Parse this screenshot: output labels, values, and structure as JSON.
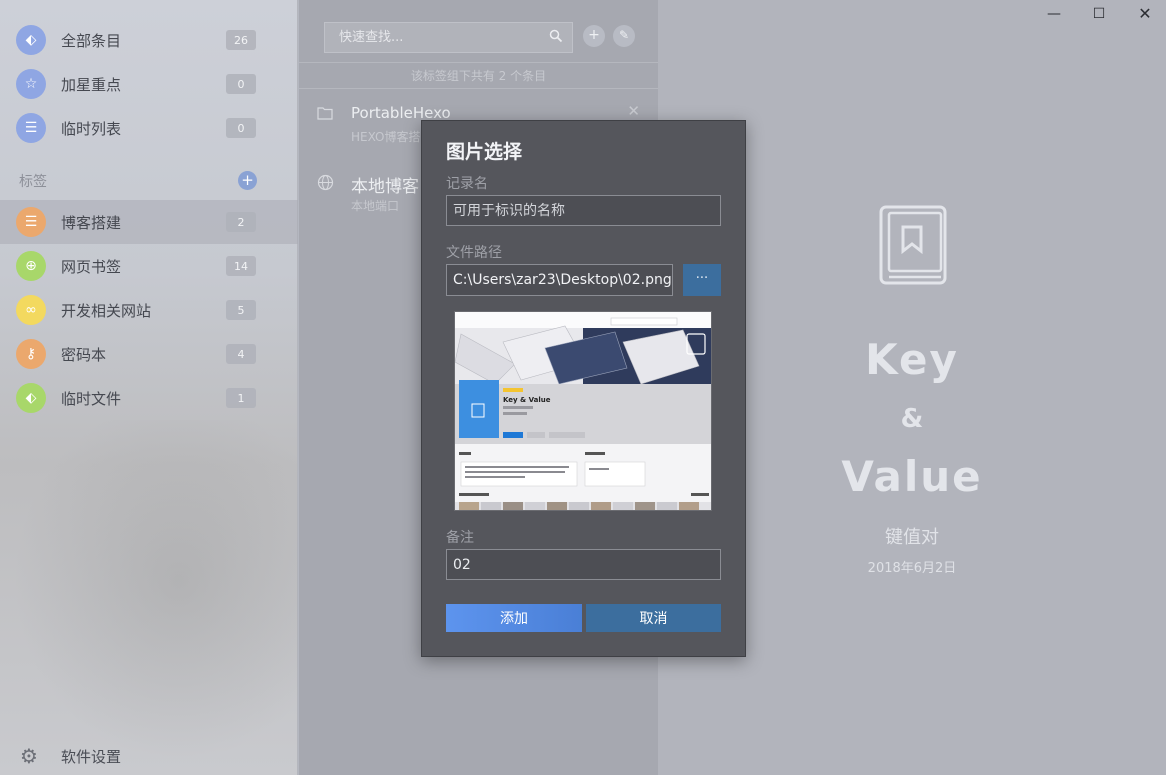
{
  "sidebar": {
    "items": [
      {
        "label": "全部条目",
        "count": "26",
        "icon": "tag-icon",
        "glyph": "⬖",
        "color": "#8fa6e3"
      },
      {
        "label": "加星重点",
        "count": "0",
        "icon": "star-icon",
        "glyph": "☆",
        "color": "#8fa6e3"
      },
      {
        "label": "临时列表",
        "count": "0",
        "icon": "list-icon",
        "glyph": "☰",
        "color": "#8fa6e3"
      }
    ],
    "tags_label": "标签",
    "tags": [
      {
        "label": "博客搭建",
        "count": "2",
        "icon": "list-icon",
        "glyph": "☰",
        "color": "#eba86d"
      },
      {
        "label": "网页书签",
        "count": "14",
        "icon": "globe-icon",
        "glyph": "⊕",
        "color": "#a8d76a"
      },
      {
        "label": "开发相关网站",
        "count": "5",
        "icon": "link-icon",
        "glyph": "∞",
        "color": "#f3d95f"
      },
      {
        "label": "密码本",
        "count": "4",
        "icon": "key-icon",
        "glyph": "⚷",
        "color": "#eba86d"
      },
      {
        "label": "临时文件",
        "count": "1",
        "icon": "tag-icon",
        "glyph": "⬖",
        "color": "#a8d76a"
      }
    ],
    "settings_label": "软件设置"
  },
  "list": {
    "search_placeholder": "快速查找...",
    "summary": "该标签组下共有 2 个条目",
    "entries": [
      {
        "title": "PortableHexo",
        "subtitle": "HEXO博客搭",
        "icon": "folder-icon"
      },
      {
        "title": "本地博客",
        "subtitle": "本地端口",
        "icon": "globe-icon"
      }
    ]
  },
  "dialog": {
    "title": "图片选择",
    "name_label": "记录名",
    "name_placeholder": "可用于标识的名称",
    "path_label": "文件路径",
    "path_value": "C:\\Users\\zar23\\Desktop\\02.png",
    "browse_label": "···",
    "preview_title": "Key & Value",
    "note_label": "备注",
    "note_value": "02",
    "add_label": "添加",
    "cancel_label": "取消"
  },
  "brand": {
    "key": "Key",
    "amp": "&",
    "value": "Value",
    "subtitle": "键值对",
    "date": "2018年6月2日"
  },
  "colors": {
    "accent_blue": "#3c6e9e",
    "add_button": "#5d94ee"
  }
}
